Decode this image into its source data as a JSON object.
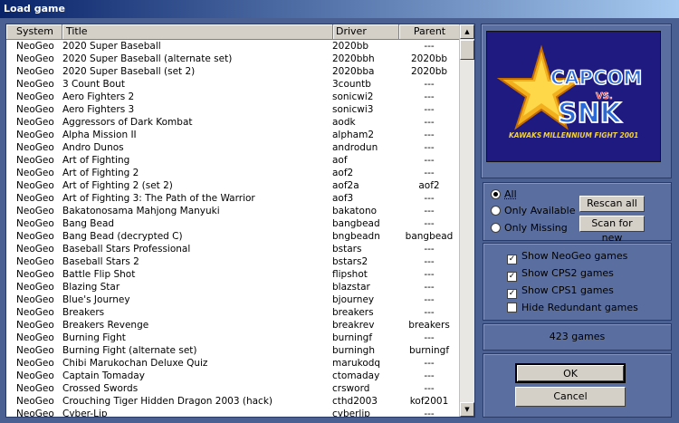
{
  "window": {
    "title": "Load game"
  },
  "columns": {
    "system": "System",
    "title": "Title",
    "driver": "Driver",
    "parent": "Parent"
  },
  "rows": [
    {
      "system": "NeoGeo",
      "title": "2020 Super Baseball",
      "driver": "2020bb",
      "parent": "---"
    },
    {
      "system": "NeoGeo",
      "title": "2020 Super Baseball (alternate set)",
      "driver": "2020bbh",
      "parent": "2020bb"
    },
    {
      "system": "NeoGeo",
      "title": "2020 Super Baseball (set 2)",
      "driver": "2020bba",
      "parent": "2020bb"
    },
    {
      "system": "NeoGeo",
      "title": "3 Count Bout",
      "driver": "3countb",
      "parent": "---"
    },
    {
      "system": "NeoGeo",
      "title": "Aero Fighters 2",
      "driver": "sonicwi2",
      "parent": "---"
    },
    {
      "system": "NeoGeo",
      "title": "Aero Fighters 3",
      "driver": "sonicwi3",
      "parent": "---"
    },
    {
      "system": "NeoGeo",
      "title": "Aggressors of Dark Kombat",
      "driver": "aodk",
      "parent": "---"
    },
    {
      "system": "NeoGeo",
      "title": "Alpha Mission II",
      "driver": "alpham2",
      "parent": "---"
    },
    {
      "system": "NeoGeo",
      "title": "Andro Dunos",
      "driver": "androdun",
      "parent": "---"
    },
    {
      "system": "NeoGeo",
      "title": "Art of Fighting",
      "driver": "aof",
      "parent": "---"
    },
    {
      "system": "NeoGeo",
      "title": "Art of Fighting 2",
      "driver": "aof2",
      "parent": "---"
    },
    {
      "system": "NeoGeo",
      "title": "Art of Fighting 2 (set 2)",
      "driver": "aof2a",
      "parent": "aof2"
    },
    {
      "system": "NeoGeo",
      "title": "Art of Fighting 3: The Path of the Warrior",
      "driver": "aof3",
      "parent": "---"
    },
    {
      "system": "NeoGeo",
      "title": "Bakatonosama Mahjong Manyuki",
      "driver": "bakatono",
      "parent": "---"
    },
    {
      "system": "NeoGeo",
      "title": "Bang Bead",
      "driver": "bangbead",
      "parent": "---"
    },
    {
      "system": "NeoGeo",
      "title": "Bang Bead (decrypted C)",
      "driver": "bngbeadn",
      "parent": "bangbead"
    },
    {
      "system": "NeoGeo",
      "title": "Baseball Stars Professional",
      "driver": "bstars",
      "parent": "---"
    },
    {
      "system": "NeoGeo",
      "title": "Baseball Stars 2",
      "driver": "bstars2",
      "parent": "---"
    },
    {
      "system": "NeoGeo",
      "title": "Battle Flip Shot",
      "driver": "flipshot",
      "parent": "---"
    },
    {
      "system": "NeoGeo",
      "title": "Blazing Star",
      "driver": "blazstar",
      "parent": "---"
    },
    {
      "system": "NeoGeo",
      "title": "Blue's Journey",
      "driver": "bjourney",
      "parent": "---"
    },
    {
      "system": "NeoGeo",
      "title": "Breakers",
      "driver": "breakers",
      "parent": "---"
    },
    {
      "system": "NeoGeo",
      "title": "Breakers Revenge",
      "driver": "breakrev",
      "parent": "breakers"
    },
    {
      "system": "NeoGeo",
      "title": "Burning Fight",
      "driver": "burningf",
      "parent": "---"
    },
    {
      "system": "NeoGeo",
      "title": "Burning Fight (alternate set)",
      "driver": "burningh",
      "parent": "burningf"
    },
    {
      "system": "NeoGeo",
      "title": "Chibi Marukochan Deluxe Quiz",
      "driver": "marukodq",
      "parent": "---"
    },
    {
      "system": "NeoGeo",
      "title": "Captain Tomaday",
      "driver": "ctomaday",
      "parent": "---"
    },
    {
      "system": "NeoGeo",
      "title": "Crossed Swords",
      "driver": "crsword",
      "parent": "---"
    },
    {
      "system": "NeoGeo",
      "title": "Crouching Tiger Hidden Dragon 2003 (hack)",
      "driver": "cthd2003",
      "parent": "kof2001"
    },
    {
      "system": "NeoGeo",
      "title": "Cyber-Lip",
      "driver": "cyberlip",
      "parent": "---"
    }
  ],
  "preview": {
    "logo_top": "CAPCOM",
    "logo_vs": "VS.",
    "logo_bottom": "SNK",
    "subtitle": "MILLENNIUM FIGHT 2001",
    "kawaks": "KAWAKS"
  },
  "filter": {
    "all": "All",
    "only_available": "Only Available",
    "only_missing": "Only Missing",
    "selected": "all"
  },
  "buttons": {
    "rescan": "Rescan all",
    "scan_new": "Scan for new",
    "ok": "OK",
    "cancel": "Cancel"
  },
  "options": {
    "show_neogeo": {
      "label": "Show NeoGeo games",
      "checked": true
    },
    "show_cps2": {
      "label": "Show CPS2 games",
      "checked": true
    },
    "show_cps1": {
      "label": "Show CPS1 games",
      "checked": true
    },
    "hide_redundant": {
      "label": "Hide Redundant games",
      "checked": false
    }
  },
  "count": "423 games",
  "colors": {
    "frame": "#4a5f92",
    "panel": "#5a6ea0",
    "titlebar": "#0a246a"
  }
}
